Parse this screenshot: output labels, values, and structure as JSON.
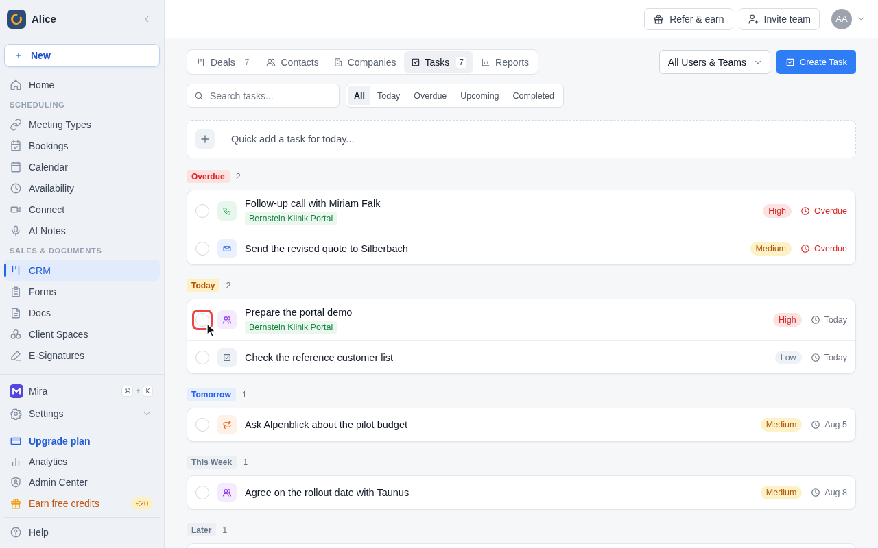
{
  "sidebar": {
    "workspace": "Alice",
    "new_button": "New",
    "home": {
      "label": "Home",
      "selected": false
    },
    "sections": [
      {
        "title": "SCHEDULING",
        "items": [
          {
            "label": "Meeting Types",
            "selected": false
          },
          {
            "label": "Bookings",
            "selected": false
          },
          {
            "label": "Calendar",
            "selected": false
          },
          {
            "label": "Availability",
            "selected": false
          },
          {
            "label": "Connect",
            "selected": false
          },
          {
            "label": "AI Notes",
            "selected": false
          }
        ]
      },
      {
        "title": "SALES & DOCUMENTS",
        "items": [
          {
            "label": "CRM",
            "selected": true
          },
          {
            "label": "Forms",
            "selected": false
          },
          {
            "label": "Docs",
            "selected": false
          },
          {
            "label": "Client Spaces",
            "selected": false
          },
          {
            "label": "E-Signatures",
            "selected": false
          }
        ]
      }
    ],
    "assistant": {
      "label": "Mira",
      "shortcut": {
        "keys": [
          "⌘",
          "K"
        ],
        "separator": "+"
      }
    },
    "settings": {
      "label": "Settings"
    },
    "footer_links": [
      {
        "label": "Upgrade plan",
        "kind": "upgrade"
      },
      {
        "label": "Analytics",
        "kind": "plain"
      },
      {
        "label": "Admin Center",
        "kind": "plain"
      },
      {
        "label": "Earn free credits",
        "kind": "reward",
        "badge": "€20"
      }
    ],
    "help": {
      "label": "Help"
    }
  },
  "topbar": {
    "buttons": [
      {
        "label": "Refer & earn"
      },
      {
        "label": "Invite team"
      }
    ],
    "avatar": "AA"
  },
  "tabs": [
    {
      "label": "Deals",
      "count": "7",
      "selected": false
    },
    {
      "label": "Contacts",
      "selected": false
    },
    {
      "label": "Companies",
      "selected": false
    },
    {
      "label": "Tasks",
      "count": "7",
      "selected": true
    },
    {
      "label": "Reports",
      "selected": false
    }
  ],
  "owner_filter": {
    "value": "All Users & Teams"
  },
  "create_button": {
    "label": "Create Task"
  },
  "search": {
    "placeholder": "Search tasks..."
  },
  "filters": [
    {
      "label": "All",
      "selected": true
    },
    {
      "label": "Today",
      "selected": false
    },
    {
      "label": "Overdue",
      "selected": false
    },
    {
      "label": "Upcoming",
      "selected": false
    },
    {
      "label": "Completed",
      "selected": false
    }
  ],
  "quick_add": {
    "placeholder": "Quick add a task for today..."
  },
  "groups": [
    {
      "label": "Overdue",
      "kind": "overdue",
      "count": "2",
      "tasks": [
        {
          "title": "Follow-up call with Miriam Falk",
          "kind": "call",
          "checked": false,
          "highlighted": false,
          "tag": "Bernstein Klinik Portal",
          "priority": {
            "label": "High",
            "kind": "high"
          },
          "due": {
            "label": "Overdue",
            "overdue": true
          }
        },
        {
          "title": "Send the revised quote to Silberbach",
          "kind": "email",
          "checked": false,
          "highlighted": false,
          "priority": {
            "label": "Medium",
            "kind": "medium"
          },
          "due": {
            "label": "Overdue",
            "overdue": true
          }
        }
      ]
    },
    {
      "label": "Today",
      "kind": "today",
      "count": "2",
      "tasks": [
        {
          "title": "Prepare the portal demo",
          "kind": "meeting",
          "checked": false,
          "highlighted": true,
          "tag": "Bernstein Klinik Portal",
          "priority": {
            "label": "High",
            "kind": "high"
          },
          "due": {
            "label": "Today",
            "overdue": false
          }
        },
        {
          "title": "Check the reference customer list",
          "kind": "todo",
          "checked": false,
          "highlighted": false,
          "priority": {
            "label": "Low",
            "kind": "low"
          },
          "due": {
            "label": "Today",
            "overdue": false
          }
        }
      ]
    },
    {
      "label": "Tomorrow",
      "kind": "tomorrow",
      "count": "1",
      "tasks": [
        {
          "title": "Ask Alpenblick about the pilot budget",
          "kind": "follow_up",
          "checked": false,
          "highlighted": false,
          "priority": {
            "label": "Medium",
            "kind": "medium"
          },
          "due": {
            "label": "Aug 5",
            "overdue": false
          }
        }
      ]
    },
    {
      "label": "This Week",
      "kind": "this_week",
      "count": "1",
      "tasks": [
        {
          "title": "Agree on the rollout date with Taunus",
          "kind": "meeting",
          "checked": false,
          "highlighted": false,
          "priority": {
            "label": "Medium",
            "kind": "medium"
          },
          "due": {
            "label": "Aug 8",
            "overdue": false
          }
        }
      ]
    },
    {
      "label": "Later",
      "kind": "later",
      "count": "1"
    }
  ]
}
